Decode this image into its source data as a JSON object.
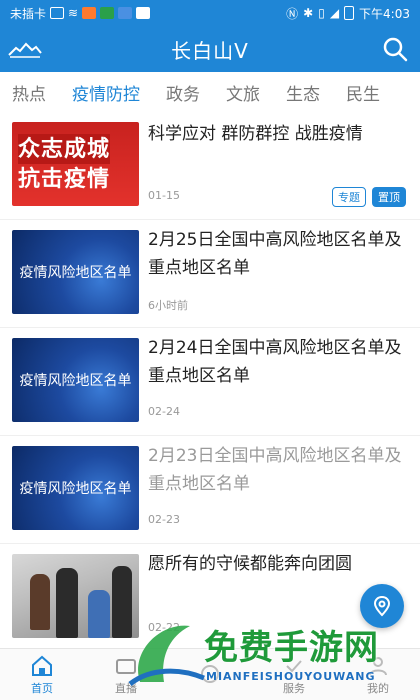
{
  "status_bar": {
    "carrier": "未插卡",
    "time": "下午4:03"
  },
  "header": {
    "title": "长白山V"
  },
  "tabs": [
    {
      "label": "热点",
      "active": false
    },
    {
      "label": "疫情防控",
      "active": true
    },
    {
      "label": "政务",
      "active": false
    },
    {
      "label": "文旅",
      "active": false
    },
    {
      "label": "生态",
      "active": false
    },
    {
      "label": "民生",
      "active": false
    }
  ],
  "feed": [
    {
      "title": "科学应对 群防群控 战胜疫情",
      "time": "01-15",
      "thumb_text_1": "众志成城",
      "thumb_text_2": "抗击疫情",
      "badge_topic": "专题",
      "badge_pinned": "置顶"
    },
    {
      "title": "2月25日全国中高风险地区名单及重点地区名单",
      "time": "6小时前",
      "thumb_text": "疫情风险地区名单"
    },
    {
      "title": "2月24日全国中高风险地区名单及重点地区名单",
      "time": "02-24",
      "thumb_text": "疫情风险地区名单"
    },
    {
      "title": "2月23日全国中高风险地区名单及重点地区名单",
      "time": "02-23",
      "thumb_text": "疫情风险地区名单"
    },
    {
      "title": "愿所有的守候都能奔向团圆",
      "time": "02-22"
    }
  ],
  "bottom_nav": [
    {
      "label": "首页",
      "active": true
    },
    {
      "label": "直播",
      "active": false
    },
    {
      "label": "",
      "active": false
    },
    {
      "label": "服务",
      "active": false
    },
    {
      "label": "我的",
      "active": false
    }
  ],
  "watermark": {
    "text": "免费手游网",
    "sub": "MIANFEISHOUYOUWANG"
  },
  "colors": {
    "brand": "#1f86d6",
    "watermark_green": "#1f9a3a"
  }
}
